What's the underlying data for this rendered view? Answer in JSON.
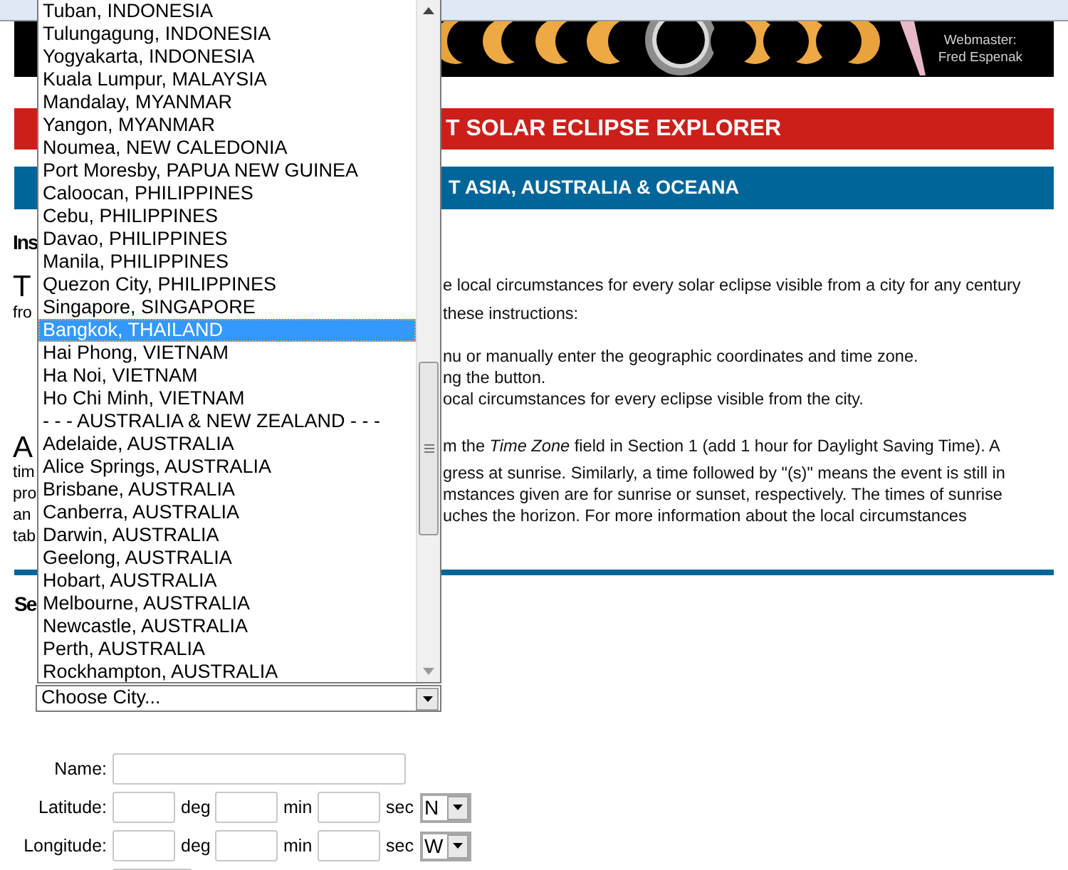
{
  "banner": {
    "credit_label": "Webmaster:",
    "credit_name": "Fred Espenak"
  },
  "title_bar": {
    "text": "T SOLAR ECLIPSE EXPLORER"
  },
  "region_bar": {
    "text": "T ASIA, AUSTRALIA & OCEANA"
  },
  "paragraphs": [
    {
      "kind": "heading",
      "lines": [
        {
          "left": "Ins"
        }
      ]
    },
    {
      "kind": "intro",
      "lines": [
        {
          "left": "T",
          "right": "e local circumstances for every solar eclipse visible from a city for any century"
        },
        {
          "left": "fro",
          "right": "these instructions:"
        }
      ]
    },
    {
      "kind": "steps",
      "lines": [
        {
          "right": "nu or manually enter the geographic coordinates and time zone."
        },
        {
          "right": "ng the button."
        },
        {
          "right": "ocal circumstances for every eclipse visible from the city."
        }
      ]
    },
    {
      "kind": "notes",
      "lines": [
        {
          "left": "A",
          "right": "m the *Time Zone* field in Section 1 (add 1 hour for Daylight Saving Time). A"
        },
        {
          "left": "tim",
          "right": "gress at sunrise. Similarly, a time followed by \"(s)\" means the event is still in"
        },
        {
          "left": "pro",
          "right": "mstances given are for sunrise or sunset, respectively. The times of sunrise"
        },
        {
          "left": "an",
          "right": "uches the horizon. For more information about the local circumstances"
        },
        {
          "left": "tab"
        }
      ]
    }
  ],
  "section_heading": "Se",
  "city_select": {
    "value": "Choose City..."
  },
  "city_list": [
    {
      "label": "Tuban, INDONESIA",
      "selected": false
    },
    {
      "label": "Tulungagung, INDONESIA",
      "selected": false
    },
    {
      "label": "Yogyakarta, INDONESIA",
      "selected": false
    },
    {
      "label": "Kuala Lumpur, MALAYSIA",
      "selected": false
    },
    {
      "label": "Mandalay, MYANMAR",
      "selected": false
    },
    {
      "label": "Yangon, MYANMAR",
      "selected": false
    },
    {
      "label": "Noumea, NEW CALEDONIA",
      "selected": false
    },
    {
      "label": "Port Moresby, PAPUA NEW GUINEA",
      "selected": false
    },
    {
      "label": "Caloocan, PHILIPPINES",
      "selected": false
    },
    {
      "label": "Cebu, PHILIPPINES",
      "selected": false
    },
    {
      "label": "Davao, PHILIPPINES",
      "selected": false
    },
    {
      "label": "Manila, PHILIPPINES",
      "selected": false
    },
    {
      "label": "Quezon City, PHILIPPINES",
      "selected": false
    },
    {
      "label": "Singapore, SINGAPORE",
      "selected": false
    },
    {
      "label": "Bangkok, THAILAND",
      "selected": true
    },
    {
      "label": "Hai Phong, VIETNAM",
      "selected": false
    },
    {
      "label": "Ha Noi, VIETNAM",
      "selected": false
    },
    {
      "label": "Ho Chi Minh, VIETNAM",
      "selected": false
    },
    {
      "label": "- - -  AUSTRALIA & NEW ZEALAND - - -",
      "selected": false
    },
    {
      "label": "Adelaide, AUSTRALIA",
      "selected": false
    },
    {
      "label": "Alice Springs, AUSTRALIA",
      "selected": false
    },
    {
      "label": "Brisbane, AUSTRALIA",
      "selected": false
    },
    {
      "label": "Canberra, AUSTRALIA",
      "selected": false
    },
    {
      "label": "Darwin, AUSTRALIA",
      "selected": false
    },
    {
      "label": "Geelong, AUSTRALIA",
      "selected": false
    },
    {
      "label": "Hobart, AUSTRALIA",
      "selected": false
    },
    {
      "label": "Melbourne, AUSTRALIA",
      "selected": false
    },
    {
      "label": "Newcastle, AUSTRALIA",
      "selected": false
    },
    {
      "label": "Perth, AUSTRALIA",
      "selected": false
    },
    {
      "label": "Rockhampton, AUSTRALIA",
      "selected": false
    }
  ],
  "form_rows": [
    {
      "kind": "text",
      "label": "Name:"
    },
    {
      "kind": "dms",
      "label": "Latitude:",
      "units": [
        "deg",
        "min",
        "sec"
      ],
      "hemisphere": "N"
    },
    {
      "kind": "dms",
      "label": "Longitude:",
      "units": [
        "deg",
        "min",
        "sec"
      ],
      "hemisphere": "W"
    },
    {
      "kind": "short"
    }
  ]
}
